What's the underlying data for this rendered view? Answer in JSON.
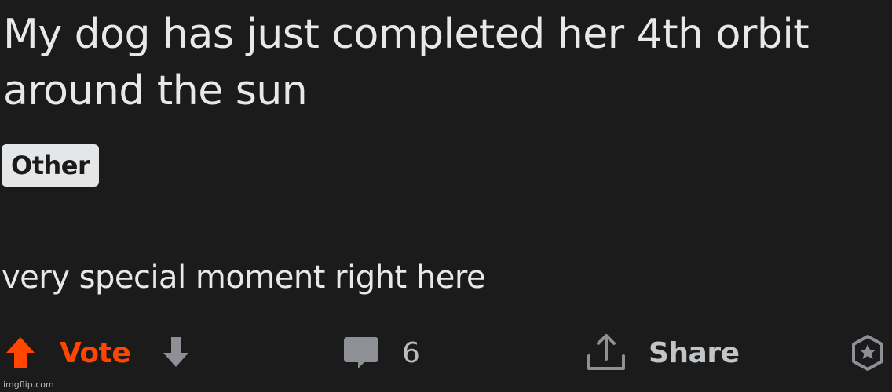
{
  "post": {
    "title": "My dog has just completed her 4th orbit around the sun",
    "flair": "Other",
    "body": "very special moment right here"
  },
  "actions": {
    "vote_label": "Vote",
    "comment_count": "6",
    "share_label": "Share"
  },
  "icons": {
    "upvote": "upvote-arrow-icon",
    "downvote": "downvote-arrow-icon",
    "comment": "comment-bubble-icon",
    "share": "share-upload-icon",
    "award": "award-badge-icon"
  },
  "colors": {
    "background": "#1a1a1b",
    "upvote_active": "#ff4500",
    "text": "#e6e8e9",
    "muted": "#c2c5c8",
    "flair_bg": "#e4e6e8"
  },
  "watermark": "imgflip.com"
}
